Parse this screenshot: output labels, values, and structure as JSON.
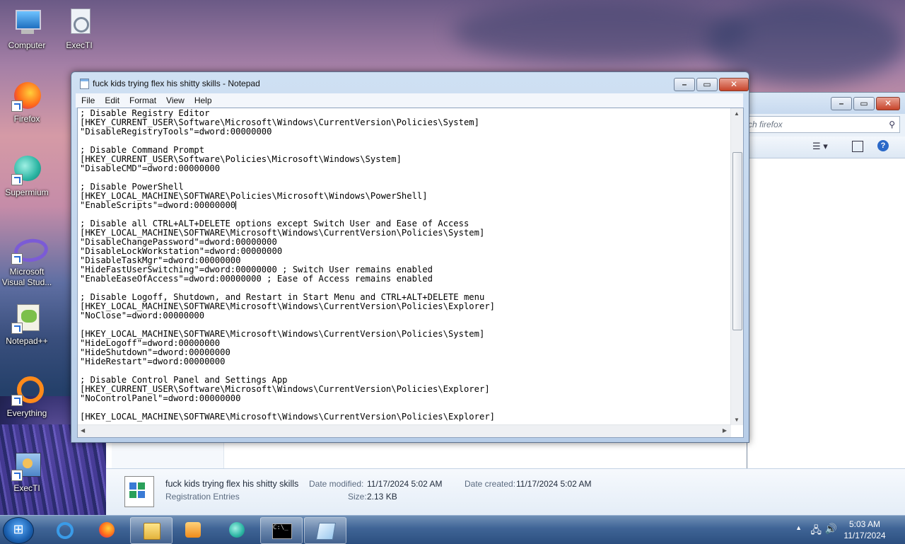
{
  "desktop": {
    "icons": [
      {
        "label": "Computer",
        "icon": "computer-icon"
      },
      {
        "label": "ExecTI",
        "icon": "execti-icon"
      },
      {
        "label": "Firefox",
        "icon": "firefox-icon"
      },
      {
        "label": "Supermium",
        "icon": "supermium-icon"
      },
      {
        "label": "Microsoft Visual Stud...",
        "icon": "visual-studio-icon"
      },
      {
        "label": "Notepad++",
        "icon": "notepadpp-icon"
      },
      {
        "label": "Everything",
        "icon": "everything-icon"
      },
      {
        "label": "ExecTI",
        "icon": "execti-icon"
      }
    ]
  },
  "explorer": {
    "search_placeholder": "ch firefox",
    "details": {
      "file_name": "fuck kids trying flex his shitty skills",
      "file_type": "Registration Entries",
      "date_modified_label": "Date modified:",
      "date_modified": "11/17/2024 5:02 AM",
      "date_created_label": "Date created:",
      "date_created": "11/17/2024 5:02 AM",
      "size_label": "Size:",
      "size": "2.13 KB"
    }
  },
  "notepad": {
    "title": "fuck kids trying flex his shitty skills - Notepad",
    "menu": [
      "File",
      "Edit",
      "Format",
      "View",
      "Help"
    ],
    "lines": [
      "; Disable Registry Editor",
      "[HKEY_CURRENT_USER\\Software\\Microsoft\\Windows\\CurrentVersion\\Policies\\System]",
      "\"DisableRegistryTools\"=dword:00000000",
      "",
      "; Disable Command Prompt",
      "[HKEY_CURRENT_USER\\Software\\Policies\\Microsoft\\Windows\\System]",
      "\"DisableCMD\"=dword:00000000",
      "",
      "; Disable PowerShell",
      "[HKEY_LOCAL_MACHINE\\SOFTWARE\\Policies\\Microsoft\\Windows\\PowerShell]",
      "\"EnableScripts\"=dword:00000000",
      "",
      "; Disable all CTRL+ALT+DELETE options except Switch User and Ease of Access",
      "[HKEY_LOCAL_MACHINE\\SOFTWARE\\Microsoft\\Windows\\CurrentVersion\\Policies\\System]",
      "\"DisableChangePassword\"=dword:00000000",
      "\"DisableLockWorkstation\"=dword:00000000",
      "\"DisableTaskMgr\"=dword:00000000",
      "\"HideFastUserSwitching\"=dword:00000000 ; Switch User remains enabled",
      "\"EnableEaseOfAccess\"=dword:00000000 ; Ease of Access remains enabled",
      "",
      "; Disable Logoff, Shutdown, and Restart in Start Menu and CTRL+ALT+DELETE menu",
      "[HKEY_LOCAL_MACHINE\\SOFTWARE\\Microsoft\\Windows\\CurrentVersion\\Policies\\Explorer]",
      "\"NoClose\"=dword:00000000",
      "",
      "[HKEY_LOCAL_MACHINE\\SOFTWARE\\Microsoft\\Windows\\CurrentVersion\\Policies\\System]",
      "\"HideLogoff\"=dword:00000000",
      "\"HideShutdown\"=dword:00000000",
      "\"HideRestart\"=dword:00000000",
      "",
      "; Disable Control Panel and Settings App",
      "[HKEY_CURRENT_USER\\Software\\Microsoft\\Windows\\CurrentVersion\\Policies\\Explorer]",
      "\"NoControlPanel\"=dword:00000000",
      "",
      "[HKEY_LOCAL_MACHINE\\SOFTWARE\\Microsoft\\Windows\\CurrentVersion\\Policies\\Explorer]"
    ],
    "caret_line": 10
  },
  "taskbar": {
    "items": [
      {
        "name": "internet-explorer",
        "icon": "ie-icon"
      },
      {
        "name": "firefox",
        "icon": "firefox-icon"
      },
      {
        "name": "file-explorer",
        "icon": "folder-icon"
      },
      {
        "name": "media-player",
        "icon": "media-player-icon"
      },
      {
        "name": "supermium",
        "icon": "supermium-icon"
      },
      {
        "name": "command-prompt",
        "icon": "cmd-icon"
      },
      {
        "name": "notepad",
        "icon": "notepad-icon"
      }
    ],
    "time": "5:03 AM",
    "date": "11/17/2024"
  }
}
